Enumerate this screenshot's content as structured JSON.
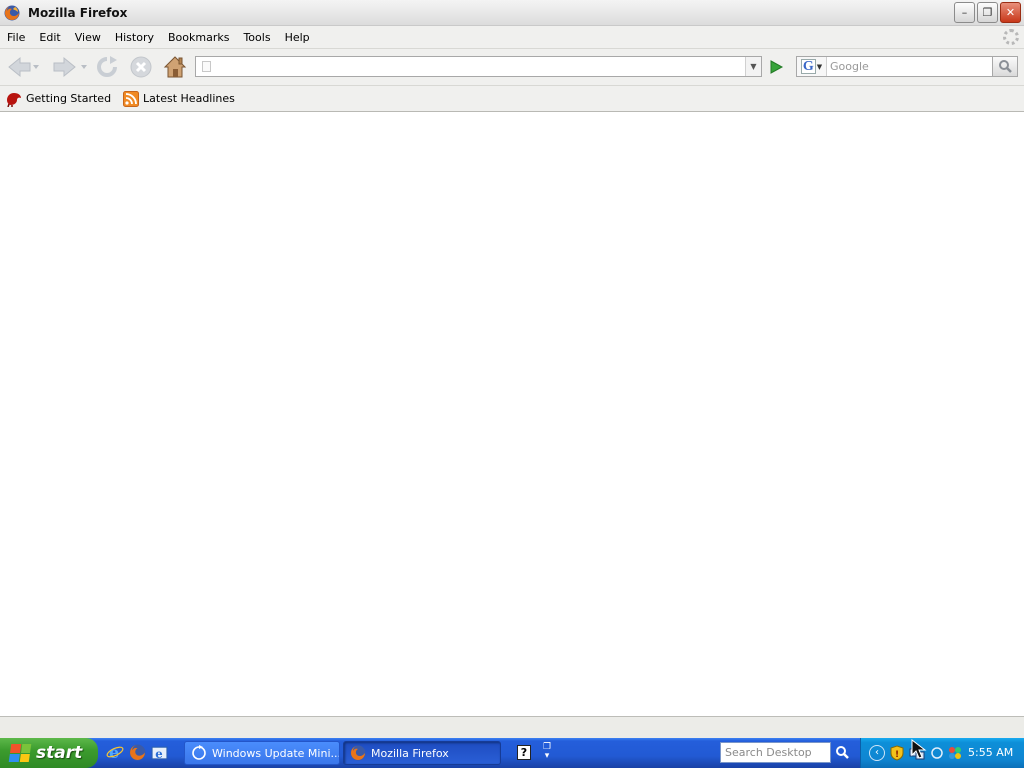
{
  "window": {
    "title": "Mozilla Firefox",
    "controls": {
      "minimize": "–",
      "restore": "❐",
      "close": "✕"
    }
  },
  "menubar": {
    "items": [
      "File",
      "Edit",
      "View",
      "History",
      "Bookmarks",
      "Tools",
      "Help"
    ]
  },
  "navbar": {
    "url_value": "",
    "search_placeholder": "Google",
    "search_engine": "G"
  },
  "bookmarks": {
    "items": [
      "Getting Started",
      "Latest Headlines"
    ]
  },
  "taskbar": {
    "start_label": "start",
    "tasks": [
      {
        "label": "Windows Update Mini...",
        "active": false
      },
      {
        "label": "Mozilla Firefox",
        "active": true
      }
    ],
    "help_glyph": "?",
    "desktop_search_placeholder": "Search Desktop",
    "clock": "5:55 AM",
    "tray_chevron": "‹"
  },
  "colors": {
    "taskbar_blue": "#245edb",
    "start_green": "#3c9c2e",
    "tray_blue": "#0f86d2",
    "close_red": "#c8381a"
  },
  "icons": [
    "firefox-logo-icon",
    "back-icon",
    "forward-icon",
    "reload-icon",
    "stop-icon",
    "home-icon",
    "go-icon",
    "search-icon",
    "bookmark-firefox-icon",
    "rss-feed-icon",
    "windows-flag-icon",
    "internet-explorer-icon",
    "outlook-express-icon",
    "help-icon",
    "shield-icon",
    "network-icon",
    "cursor-icon"
  ]
}
